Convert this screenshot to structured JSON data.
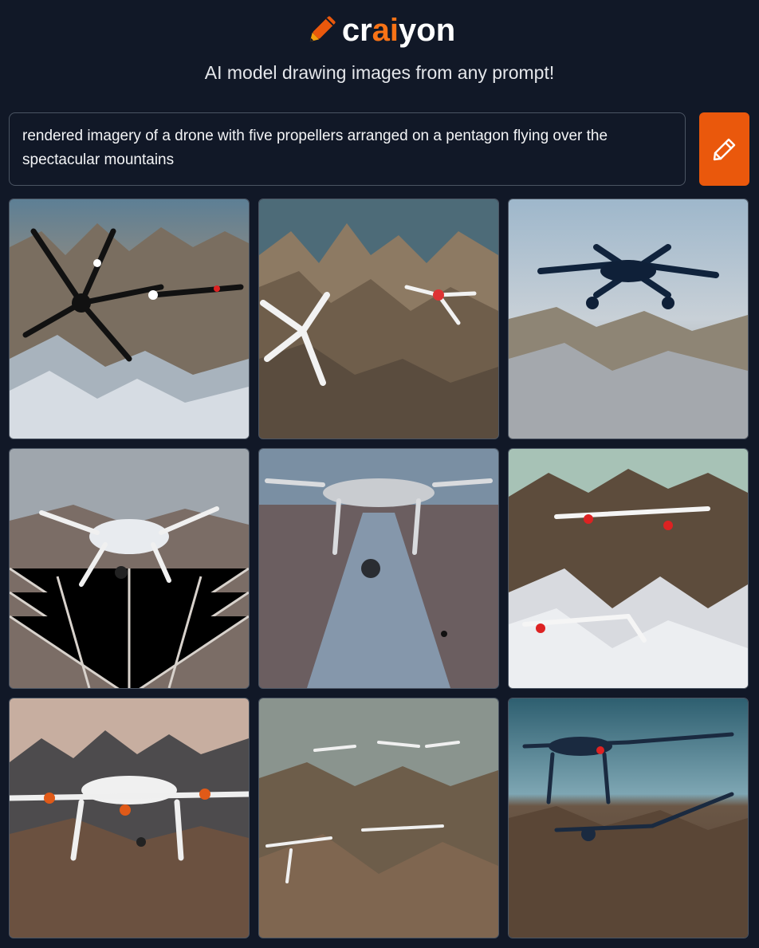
{
  "header": {
    "logo_prefix": "cr",
    "logo_ai": "ai",
    "logo_suffix": "yon",
    "tagline": "AI model drawing images from any prompt!"
  },
  "prompt": {
    "value": "rendered imagery of a drone with five propellers arranged on a pentagon flying over the spectacular mountains"
  },
  "draw_button": {
    "icon": "pencil-icon"
  },
  "colors": {
    "background": "#111827",
    "accent": "#ea580c",
    "logo_ai": "#f97316",
    "border": "#4b5563"
  },
  "images": [
    {
      "subject": "black multi-arm drone over snowy peaks"
    },
    {
      "subject": "white propellers over jagged brown ridges"
    },
    {
      "subject": "dark blue quadcopter above mountain range"
    },
    {
      "subject": "white quadcopter over grid-like terrain"
    },
    {
      "subject": "grey drone with camera over red valley"
    },
    {
      "subject": "white-red drones between rocky peaks"
    },
    {
      "subject": "white drone with orange rotors on ridge"
    },
    {
      "subject": "formation of small drones over desert mountains"
    },
    {
      "subject": "blue-sky drones over brown highlands"
    }
  ]
}
